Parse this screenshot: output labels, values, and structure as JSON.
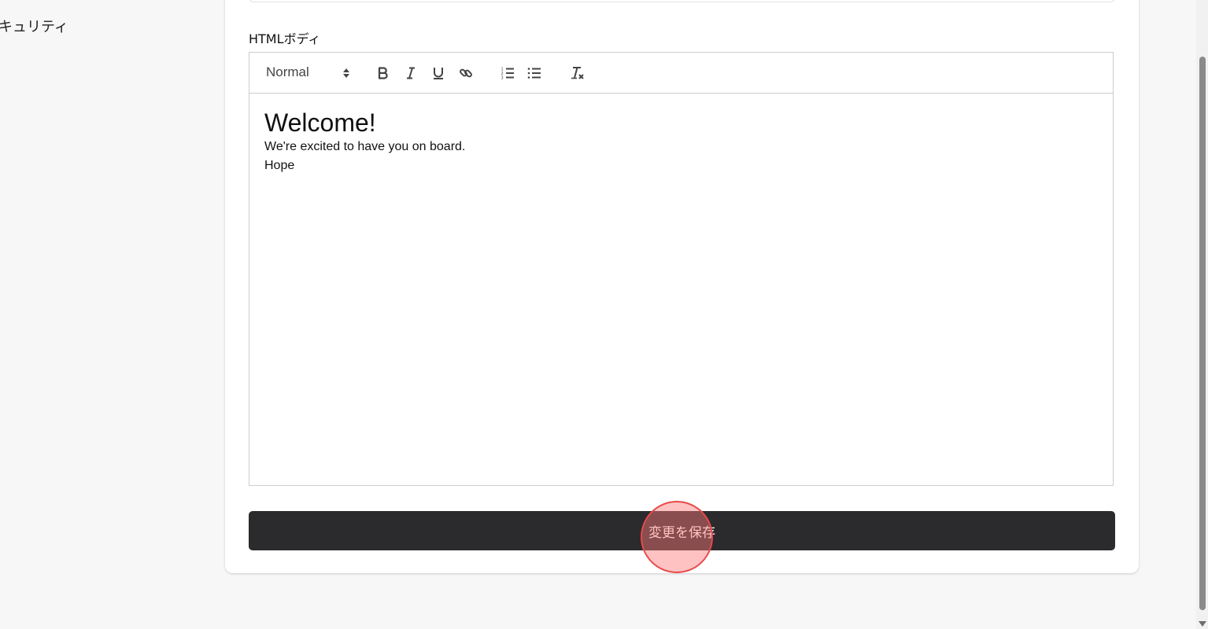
{
  "sidebar": {
    "security_label_fragment": "キュリティ"
  },
  "form": {
    "html_body_label": "HTMLボディ",
    "editor": {
      "toolbar": {
        "format_select": "Normal",
        "buttons": {
          "bold": "bold-icon",
          "italic": "italic-icon",
          "underline": "underline-icon",
          "link": "link-icon",
          "ordered_list": "ordered-list-icon",
          "bullet_list": "bullet-list-icon",
          "clear_format": "clear-format-icon"
        }
      },
      "content": {
        "heading": "Welcome!",
        "line1": "We're excited to have you on board.",
        "line2": "Hope"
      }
    },
    "save_button_label": "変更を保存"
  },
  "colors": {
    "page_background": "#f7f7f8",
    "card_background": "#ffffff",
    "save_button": "#2b2b2e",
    "click_marker": "#e84a4a"
  }
}
